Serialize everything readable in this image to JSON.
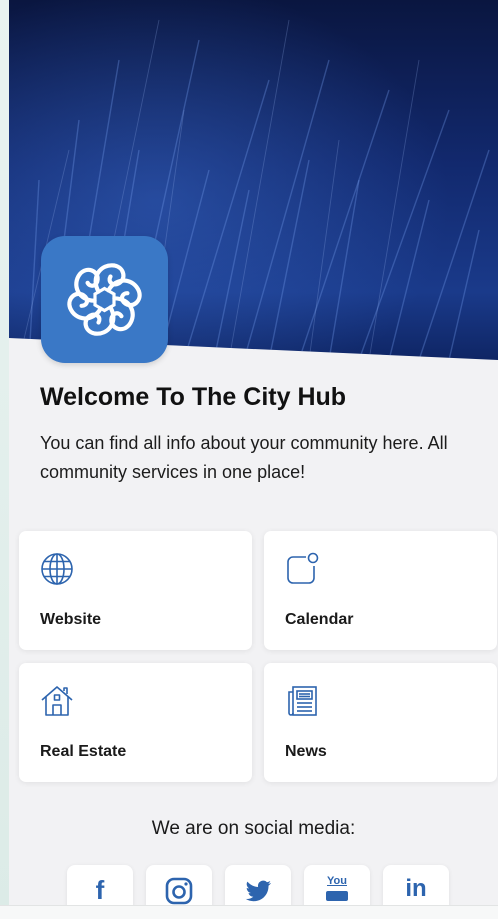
{
  "welcome": {
    "title": "Welcome To The City Hub",
    "description": "You can find all info about your community here. All community services in one place!"
  },
  "tiles": [
    {
      "label": "Website",
      "icon": "globe-icon"
    },
    {
      "label": "Calendar",
      "icon": "calendar-icon"
    },
    {
      "label": "Real Estate",
      "icon": "house-icon"
    },
    {
      "label": "News",
      "icon": "newspaper-icon"
    }
  ],
  "social": {
    "heading": "We are on social media:",
    "items": [
      {
        "name": "facebook",
        "glyph": "f",
        "icon": "facebook-icon"
      },
      {
        "name": "instagram",
        "glyph": "",
        "icon": "instagram-icon"
      },
      {
        "name": "twitter",
        "glyph": "",
        "icon": "twitter-icon"
      },
      {
        "name": "youtube",
        "glyph": "You",
        "icon": "youtube-icon"
      },
      {
        "name": "linkedin",
        "glyph": "in",
        "icon": "linkedin-icon"
      }
    ]
  },
  "colors": {
    "accent": "#2d64ae",
    "app_icon": "#3a78c6",
    "hero_dark": "#0b1a4a",
    "background": "#f2f2f4"
  }
}
